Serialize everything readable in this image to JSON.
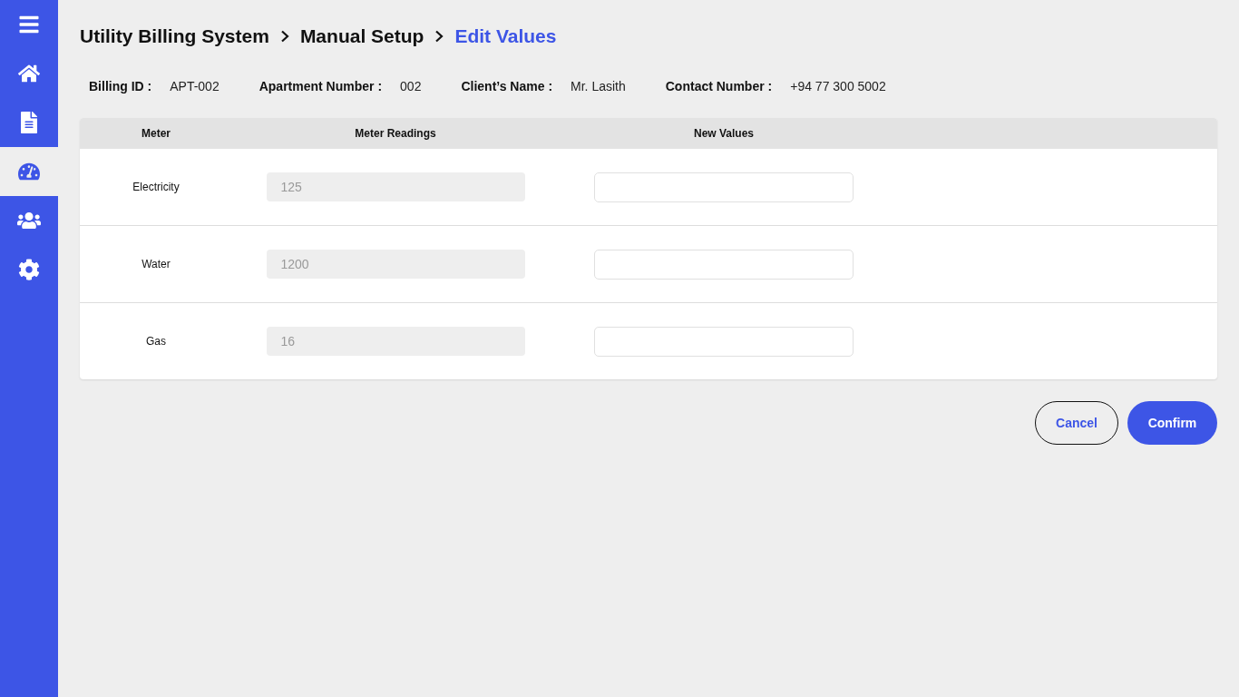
{
  "sidebar": {
    "items": [
      {
        "kind": "menu",
        "selected": false
      },
      {
        "kind": "home",
        "selected": false
      },
      {
        "kind": "document",
        "selected": false
      },
      {
        "kind": "gauge",
        "selected": true
      },
      {
        "kind": "users",
        "selected": false
      },
      {
        "kind": "settings",
        "selected": false
      }
    ]
  },
  "breadcrumb": [
    {
      "label": "Utility Billing System",
      "selected": false
    },
    {
      "label": "Manual Setup",
      "selected": false
    },
    {
      "label": "Edit Values",
      "selected": true
    }
  ],
  "info": [
    {
      "label": "Billing ID :",
      "value": "APT-002"
    },
    {
      "label": "Apartment Number :",
      "value": "002"
    },
    {
      "label": "Client’s Name :",
      "value": "Mr. Lasith"
    },
    {
      "label": "Contact Number :",
      "value": "+94 77 300 5002"
    }
  ],
  "table": {
    "columns": [
      "Meter",
      "Meter Readings",
      "New Values"
    ],
    "rows": [
      {
        "meter": "Electricity",
        "reading": "125"
      },
      {
        "meter": "Water",
        "reading": "1200"
      },
      {
        "meter": "Gas",
        "reading": "16"
      }
    ]
  },
  "buttons": [
    {
      "label": "Cancel",
      "kind": "secondary"
    },
    {
      "label": "Confirm",
      "kind": "primary"
    }
  ]
}
